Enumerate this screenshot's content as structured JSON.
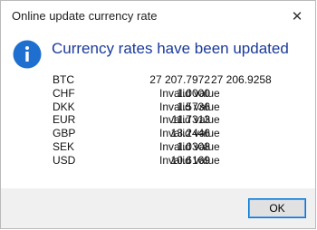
{
  "window": {
    "title": "Online update currency rate",
    "close_glyph": "✕"
  },
  "message": {
    "icon": "info-icon",
    "heading": "Currency rates have been updated"
  },
  "rates": [
    {
      "code": "BTC",
      "value1": "27 207.7972",
      "value2": "27 206.9258",
      "invalid": false
    },
    {
      "code": "CHF",
      "value1": "1.0000",
      "value2": "Invalid value",
      "invalid": true
    },
    {
      "code": "DKK",
      "value1": "1.5736",
      "value2": "Invalid value",
      "invalid": true
    },
    {
      "code": "EUR",
      "value1": "11.7313",
      "value2": "Invalid value",
      "invalid": true
    },
    {
      "code": "GBP",
      "value1": "13.2446",
      "value2": "Invalid value",
      "invalid": true
    },
    {
      "code": "SEK",
      "value1": "1.0308",
      "value2": "Invalid value",
      "invalid": true
    },
    {
      "code": "USD",
      "value1": "10.6169",
      "value2": "Invalid value",
      "invalid": true
    }
  ],
  "footer": {
    "ok_label": "OK"
  },
  "colors": {
    "heading": "#1a3a9a",
    "icon_fill": "#1e6fd0",
    "ok_border": "#0078d7"
  }
}
